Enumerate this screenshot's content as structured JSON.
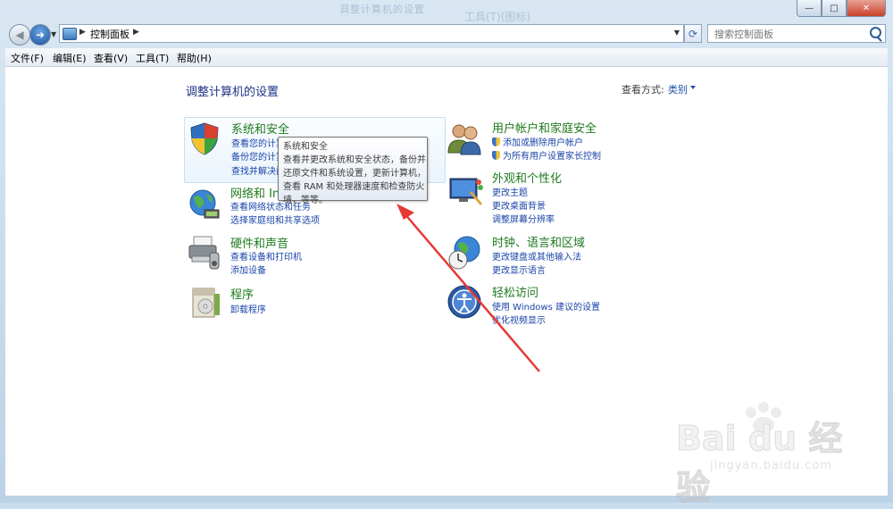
{
  "window": {
    "faded_title_1": "调整计算机的设置",
    "faded_title_2": "工具(T)(图标)",
    "controls": {
      "minimize": "—",
      "maximize": "□",
      "close": "✕"
    }
  },
  "nav": {
    "back_glyph": "◀",
    "forward_glyph": "➜",
    "breadcrumb": [
      "控制面板"
    ],
    "refresh_glyph": "⟳",
    "search_placeholder": "搜索控制面板"
  },
  "menu": [
    "文件(F)",
    "编辑(E)",
    "查看(V)",
    "工具(T)",
    "帮助(H)"
  ],
  "main": {
    "title": "调整计算机的设置",
    "view_by_label": "查看方式:",
    "view_by_value": "类别"
  },
  "categories": [
    {
      "icon": "system-security-icon",
      "title": "系统和安全",
      "links": [
        "查看您的计算机状态",
        "备份您的计算机",
        "查找并解决问题"
      ]
    },
    {
      "icon": "network-internet-icon",
      "title": "网络和 Internet",
      "links": [
        "查看网络状态和任务",
        "选择家庭组和共享选项"
      ]
    },
    {
      "icon": "hardware-sound-icon",
      "title": "硬件和声音",
      "links": [
        "查看设备和打印机",
        "添加设备"
      ]
    },
    {
      "icon": "programs-icon",
      "title": "程序",
      "links": [
        "卸载程序"
      ]
    },
    {
      "icon": "user-accounts-icon",
      "title": "用户帐户和家庭安全",
      "links": [
        "添加或删除用户帐户",
        "为所有用户设置家长控制"
      ]
    },
    {
      "icon": "appearance-icon",
      "title": "外观和个性化",
      "links": [
        "更改主题",
        "更改桌面背景",
        "调整屏幕分辨率"
      ]
    },
    {
      "icon": "clock-region-icon",
      "title": "时钟、语言和区域",
      "links": [
        "更改键盘或其他输入法",
        "更改显示语言"
      ]
    },
    {
      "icon": "ease-of-access-icon",
      "title": "轻松访问",
      "links": [
        "使用 Windows 建议的设置",
        "优化视频显示"
      ]
    }
  ],
  "tooltip": {
    "lines": [
      "系统和安全",
      "查看并更改系统和安全状态，备份并",
      "还原文件和系统设置，更新计算机，",
      "查看 RAM 和处理器速度和检查防火",
      "墙，等等。"
    ]
  },
  "watermark": {
    "brand": "Bai du 经验",
    "url": "jingyan.baidu.com"
  },
  "colors": {
    "link": "#1a44a8",
    "category_title": "#1f7a1f",
    "heading": "#1e3287",
    "annotation_arrow": "#e53a35"
  }
}
